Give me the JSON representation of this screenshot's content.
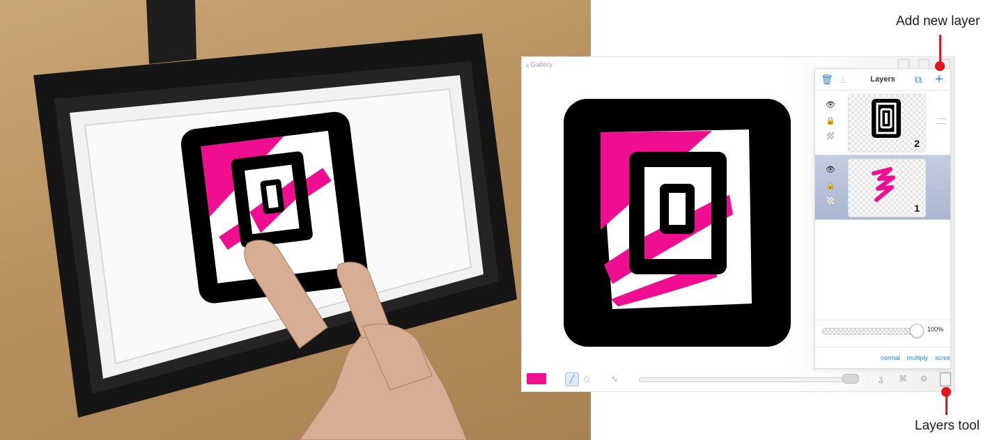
{
  "photo": {
    "alt": "Hand drawing on iPad"
  },
  "app": {
    "nav": {
      "gallery_label": "Gallery"
    },
    "layers_panel": {
      "title": "Layers",
      "layers": [
        {
          "number": "2",
          "visible": true,
          "locked": true
        },
        {
          "number": "1",
          "visible": true,
          "locked": true,
          "selected": true
        }
      ],
      "opacity_value": "100%",
      "opacity_fraction": 1.0,
      "blend_modes": [
        "normal",
        "multiply",
        "scree"
      ]
    },
    "toolbar": {
      "color_swatch": "#ee0e8f"
    }
  },
  "annotations": {
    "add_new_layer": "Add new layer",
    "layers_tool": "Layers tool"
  },
  "colors": {
    "accent_blue": "#2a86d9",
    "magenta": "#ee0e8f",
    "annotation_red": "#e3141c",
    "selected_row": "#a9b6d2"
  }
}
